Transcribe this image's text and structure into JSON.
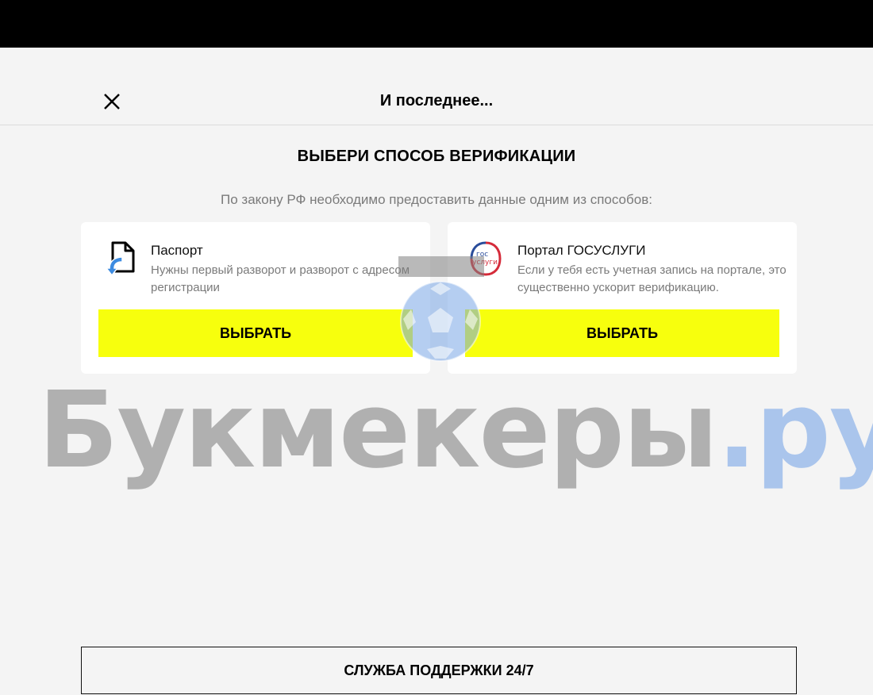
{
  "header": {
    "title": "И последнее...",
    "close_icon": "close-icon"
  },
  "section": {
    "title": "ВЫБЕРИ СПОСОБ ВЕРИФИКАЦИИ",
    "subtitle": "По закону РФ необходимо предоставить данные одним из способов:"
  },
  "options": [
    {
      "name": "Паспорт",
      "description": "Нужны первый разворот и разворот с адресом регистрации",
      "icon": "passport-document-icon",
      "button_label": "ВЫБРАТЬ"
    },
    {
      "name": "Портал ГОСУСЛУГИ",
      "description": "Если у тебя есть учетная запись на портале, это существенно ускорит верификацию.",
      "icon": "gosuslugi-icon",
      "icon_text_top": "гос",
      "icon_text_bottom": "услуги",
      "button_label": "ВЫБРАТЬ"
    }
  ],
  "support": {
    "label": "СЛУЖБА ПОДДЕРЖКИ 24/7"
  },
  "watermark": {
    "main": "Букмекеры",
    "domain": ".ру"
  },
  "colors": {
    "accent_yellow": "#f7ff0d",
    "background": "#f4f4f4",
    "topbar": "#000000"
  }
}
